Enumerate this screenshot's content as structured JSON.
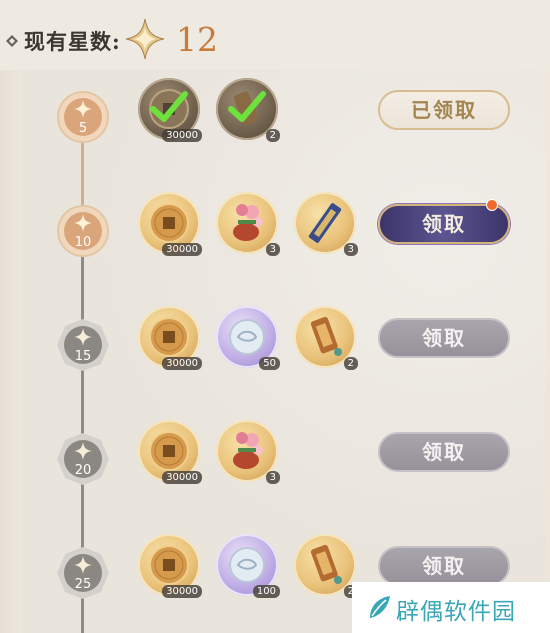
{
  "header": {
    "label": "现有星数:",
    "star_count": "12",
    "star_icon": "star-icon"
  },
  "tiers": [
    {
      "stars": "5",
      "state": "claimed",
      "rewards": [
        {
          "icon": "copper-coin-icon",
          "count": "30000",
          "claimed": true
        },
        {
          "icon": "scroll-token-icon",
          "count": "2",
          "claimed": true
        }
      ],
      "button": "已领取"
    },
    {
      "stars": "10",
      "state": "reached",
      "rewards": [
        {
          "icon": "copper-coin-icon",
          "count": "30000"
        },
        {
          "icon": "flower-drum-icon",
          "count": "3"
        },
        {
          "icon": "ink-stick-icon",
          "count": "3"
        }
      ],
      "button": "领取"
    },
    {
      "stars": "15",
      "state": "locked",
      "rewards": [
        {
          "icon": "copper-coin-icon",
          "count": "30000"
        },
        {
          "icon": "jade-disc-icon",
          "count": "50"
        },
        {
          "icon": "scroll-token-icon",
          "count": "2"
        }
      ],
      "button": "领取"
    },
    {
      "stars": "20",
      "state": "locked",
      "rewards": [
        {
          "icon": "copper-coin-icon",
          "count": "30000"
        },
        {
          "icon": "flower-drum-icon",
          "count": "3"
        }
      ],
      "button": "领取"
    },
    {
      "stars": "25",
      "state": "locked",
      "rewards": [
        {
          "icon": "copper-coin-icon",
          "count": "30000"
        },
        {
          "icon": "jade-disc-icon",
          "count": "100"
        },
        {
          "icon": "scroll-token-icon",
          "count": "2"
        }
      ],
      "button": "领取"
    }
  ],
  "watermark": {
    "text": "辟偶软件园",
    "icon": "leaf-logo-icon"
  },
  "colors": {
    "star_count": "#c77a3b",
    "active_button": "#4b4580",
    "notification_dot": "#f06a2b",
    "watermark": "#3aa7b8"
  }
}
